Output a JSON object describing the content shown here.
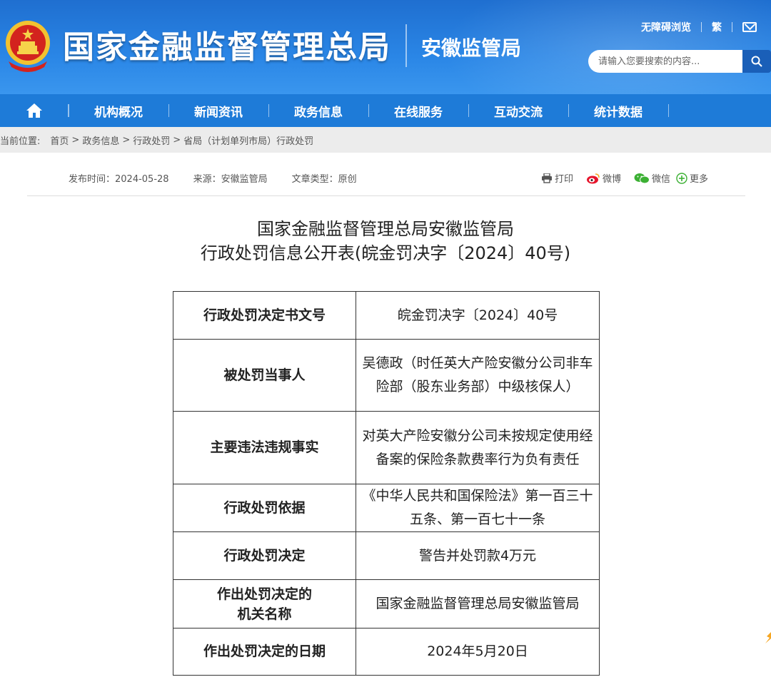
{
  "header": {
    "site_title": "国家金融监督管理总局",
    "sub_title": "安徽监管局",
    "accessibility": "无障碍浏览",
    "traditional": "繁",
    "search_placeholder": "请输入您要搜索的内容..."
  },
  "nav": {
    "items": [
      "机构概况",
      "新闻资讯",
      "政务信息",
      "在线服务",
      "互动交流",
      "统计数据"
    ]
  },
  "breadcrumb": {
    "label": "当前位置:",
    "items": [
      "首页",
      "政务信息",
      "行政处罚",
      "省局（计划单列市局）行政处罚"
    ],
    "separator": ">"
  },
  "meta": {
    "publish_time": "发布时间：2024-05-28",
    "source": "来源：安徽监管局",
    "doc_type": "文章类型：原创"
  },
  "share": {
    "print": "打印",
    "weibo": "微博",
    "wechat": "微信",
    "more": "更多"
  },
  "article": {
    "title_line1": "国家金融监督管理总局安徽监管局",
    "title_line2": "行政处罚信息公开表(皖金罚决字〔2024〕40号)"
  },
  "table": {
    "rows": [
      {
        "key": "行政处罚决定书文号",
        "value": "皖金罚决字〔2024〕40号"
      },
      {
        "key": "被处罚当事人",
        "value": "吴德政（时任英大产险安徽分公司非车险部（股东业务部）中级核保人）"
      },
      {
        "key": "主要违法违规事实",
        "value": "对英大产险安徽分公司未按规定使用经备案的保险条款费率行为负有责任"
      },
      {
        "key": "行政处罚依据",
        "value": "《中华人民共和国保险法》第一百三十五条、第一百七十一条"
      },
      {
        "key": "行政处罚决定",
        "value": "警告并处罚款4万元"
      },
      {
        "key": "作出处罚决定的机关名称",
        "value": "国家金融监督管理总局安徽监管局"
      },
      {
        "key": "作出处罚决定的日期",
        "value": "2024年5月20日"
      }
    ]
  },
  "colors": {
    "header_blue": "#2a86e6",
    "nav_blue": "#1e7bd8",
    "search_btn": "#1a5fb8",
    "breadcrumb_bg": "#ececec"
  }
}
